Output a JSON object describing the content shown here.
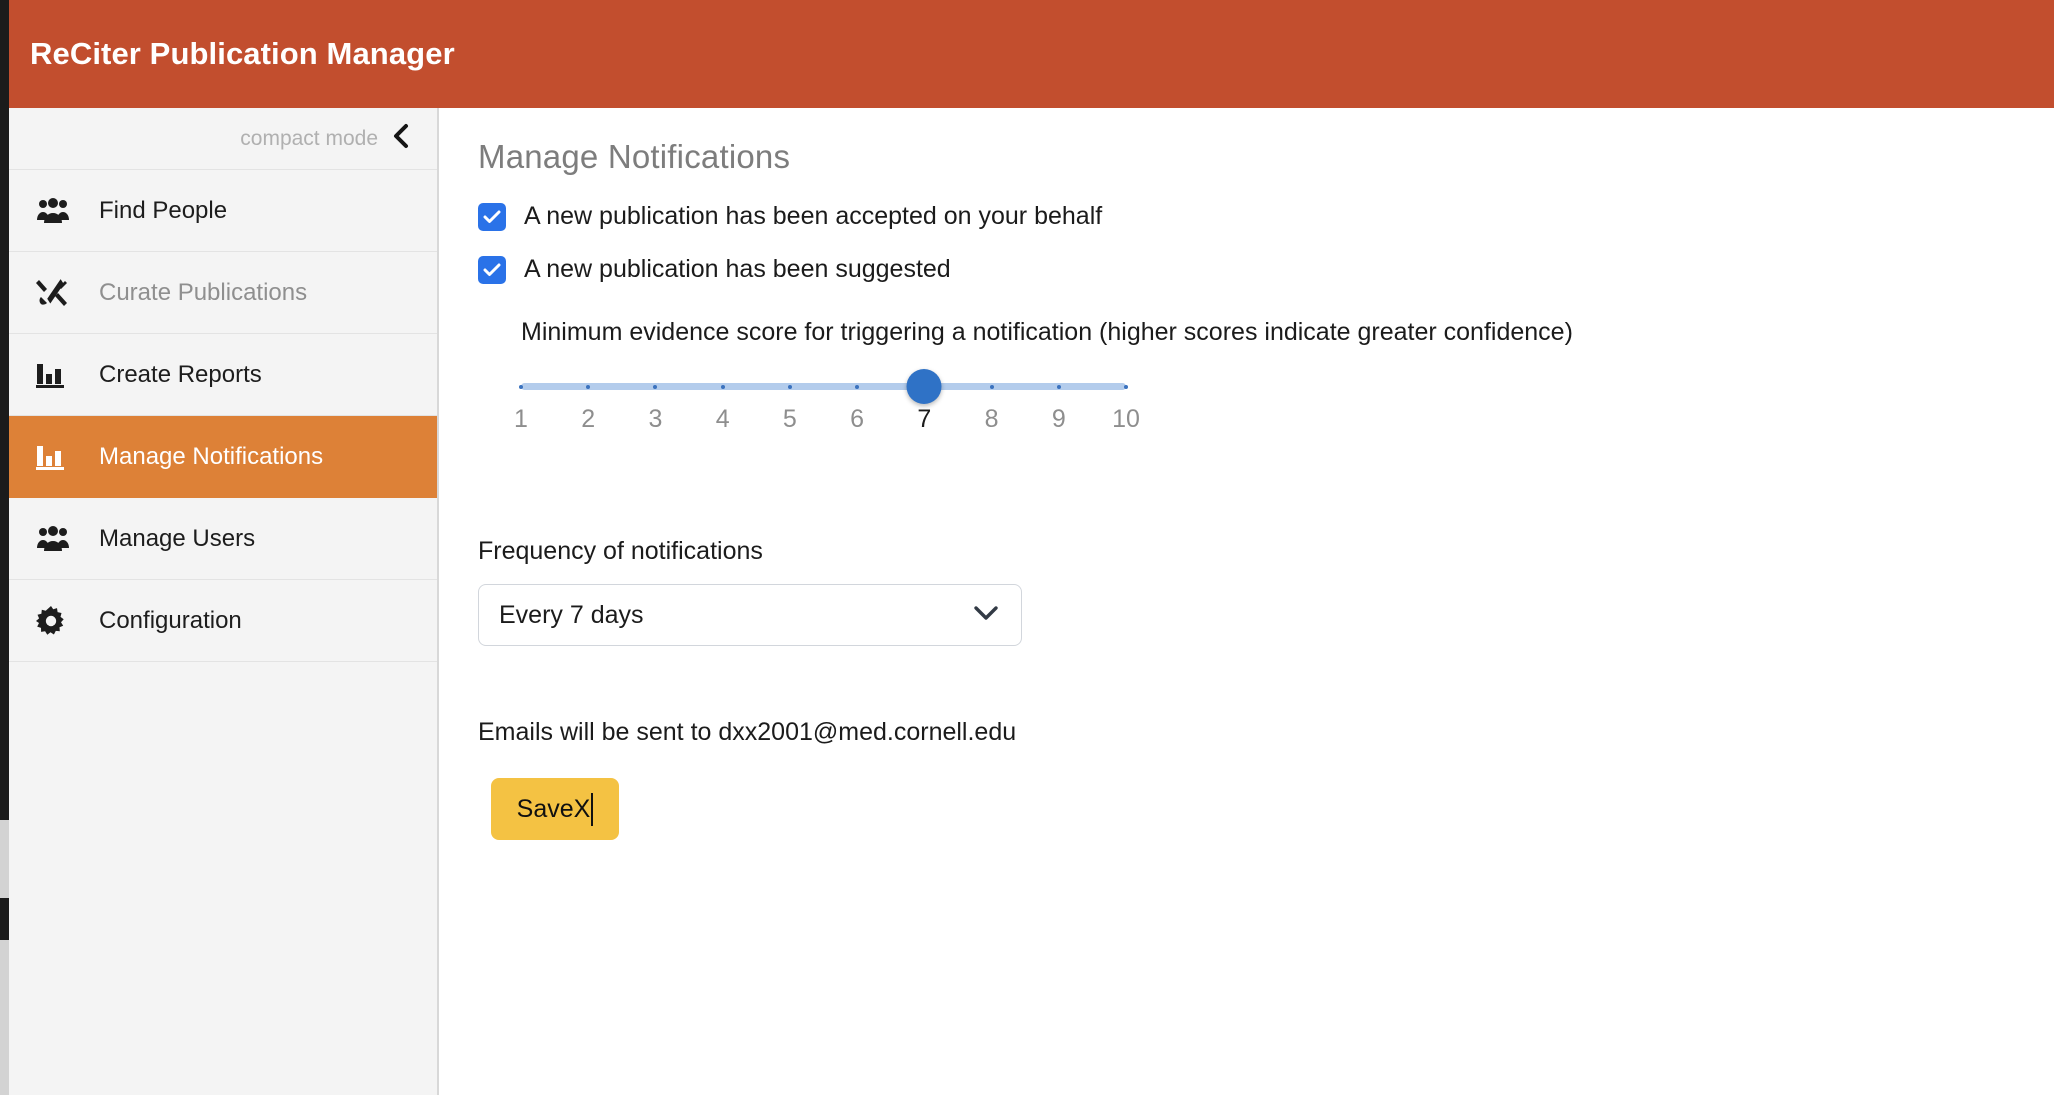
{
  "header": {
    "title": "ReCiter Publication Manager",
    "bg_color": "#c24e2e"
  },
  "sidebar": {
    "compact_mode_label": "compact mode",
    "collapse_icon": "chevron-left-icon",
    "active_bg_color": "#dd8137",
    "items": [
      {
        "label": "Find People",
        "icon": "people-group-icon",
        "state": "normal"
      },
      {
        "label": "Curate Publications",
        "icon": "tools-icon",
        "state": "disabled"
      },
      {
        "label": "Create Reports",
        "icon": "bar-chart-icon",
        "state": "normal"
      },
      {
        "label": "Manage Notifications",
        "icon": "bar-chart-icon",
        "state": "active"
      },
      {
        "label": "Manage Users",
        "icon": "people-group-icon",
        "state": "normal"
      },
      {
        "label": "Configuration",
        "icon": "gear-icon",
        "state": "normal"
      }
    ]
  },
  "main": {
    "page_title": "Manage Notifications",
    "checkboxes": [
      {
        "label": "A new publication has been accepted on your behalf",
        "checked": true
      },
      {
        "label": "A new publication has been suggested",
        "checked": true
      }
    ],
    "checkbox_color": "#2a72e8",
    "slider": {
      "help_text": "Minimum evidence score for triggering a notification (higher scores indicate greater confidence)",
      "min": 1,
      "max": 10,
      "value": 7,
      "ticks": [
        "1",
        "2",
        "3",
        "4",
        "5",
        "6",
        "7",
        "8",
        "9",
        "10"
      ],
      "thumb_color": "#2f72c6",
      "track_color": "#b3ccec"
    },
    "frequency": {
      "label": "Frequency of notifications",
      "selected": "Every 7 days",
      "chevron_icon": "chevron-down-icon"
    },
    "email_note": "Emails will be sent to dxx2001@med.cornell.edu",
    "save_button": {
      "label": "SaveX",
      "color": "#f4c243",
      "has_caret": true
    }
  }
}
